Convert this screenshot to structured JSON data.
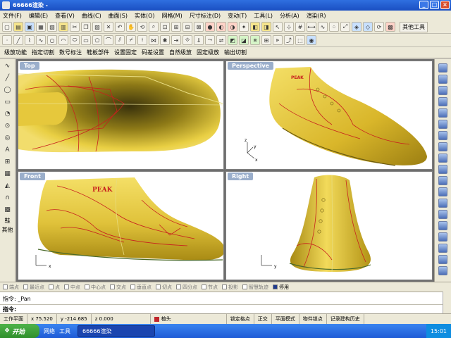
{
  "window": {
    "title": "66666渲染 - "
  },
  "menu": [
    "文件(F)",
    "编辑(E)",
    "查看(V)",
    "曲线(C)",
    "曲面(S)",
    "实体(O)",
    "网格(M)",
    "尺寸标注(D)",
    "变动(T)",
    "工具(L)",
    "分析(A)",
    "渲染(R)"
  ],
  "toolbar": {
    "other_tools": "其他工具"
  },
  "cmd_tabs": [
    "级放功能",
    "指定切割",
    "数号标注",
    "鞋板部件",
    "设置固定",
    "码差设置",
    "自然级放",
    "固定级放",
    "输出切割"
  ],
  "left_tools": {
    "last_shoe": "鞋",
    "other": "其他",
    "text_tool": "A"
  },
  "viewports": {
    "top": {
      "label": "Top"
    },
    "perspective": {
      "label": "Perspective"
    },
    "front": {
      "label": "Front",
      "brand": "PEAK"
    },
    "right": {
      "label": "Right"
    },
    "axis": {
      "x": "x",
      "y": "y",
      "z": "z"
    }
  },
  "osnap": [
    {
      "label": "端点",
      "on": false
    },
    {
      "label": "最近点",
      "on": false
    },
    {
      "label": "点",
      "on": false
    },
    {
      "label": "中点",
      "on": false
    },
    {
      "label": "中心点",
      "on": false
    },
    {
      "label": "交点",
      "on": false
    },
    {
      "label": "垂直点",
      "on": false
    },
    {
      "label": "切点",
      "on": false
    },
    {
      "label": "四分点",
      "on": false
    },
    {
      "label": "节点",
      "on": false
    },
    {
      "label": "投影",
      "on": false
    },
    {
      "label": "智慧轨迹",
      "on": false
    },
    {
      "label": "停用",
      "on": true
    }
  ],
  "command": {
    "history": "指令: _Pan",
    "prompt": "指令:"
  },
  "status": {
    "cplane": "工作平面",
    "x": "x 75.520",
    "y": "y -214.685",
    "z": "z 0.000",
    "layer": "楦头",
    "grid_snap": "锁定格点",
    "ortho": "正交",
    "planar": "平面模式",
    "osnap": "物件锁点",
    "history": "记录建构历史"
  },
  "taskbar": {
    "start": "开始",
    "network": "网络",
    "tools": "工具",
    "window": "66666渲染",
    "time": "15:01"
  },
  "colors": {
    "shoe": "#e0c23a",
    "curve_red": "#c8201e",
    "title_blue": "#2f6fe0"
  }
}
